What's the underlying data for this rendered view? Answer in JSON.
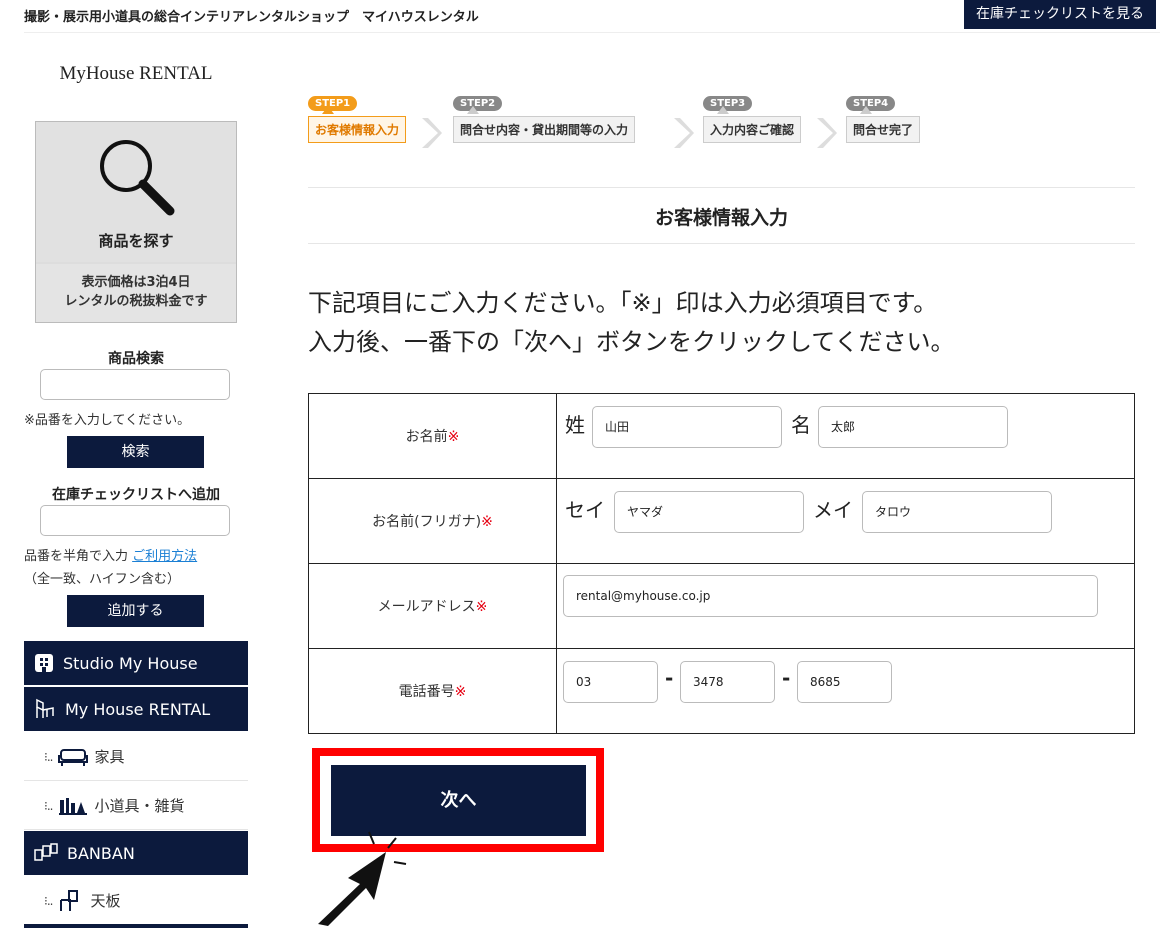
{
  "header": {
    "tagline": "撮影・展示用小道具の総合インテリアレンタルショップ　マイハウスレンタル",
    "checklist_link": "在庫チェックリストを見る"
  },
  "sidebar": {
    "logo": "MyHouse RENTAL",
    "search_box": {
      "title": "商品を探す",
      "price_note_line1": "表示価格は3泊4日",
      "price_note_line2": "レンタルの税抜料金です"
    },
    "product_search": {
      "label": "商品検索",
      "value": "",
      "note": "※品番を入力してください。",
      "button": "検索"
    },
    "checklist_add": {
      "label": "在庫チェックリストへ追加",
      "value": "",
      "note_prefix": "品番を半角で入力 ",
      "note_link": "ご利用方法",
      "note2": "（全一致、ハイフン含む）",
      "button": "追加する"
    },
    "nav": [
      {
        "label": "Studio My House",
        "icon": "building-icon"
      },
      {
        "label": "My House RENTAL",
        "icon": "chair-icon"
      },
      {
        "label": "家具",
        "icon": "sofa-icon"
      },
      {
        "label": "小道具・雑貨",
        "icon": "props-icon"
      },
      {
        "label": "BANBAN",
        "icon": "banban-logo-icon"
      },
      {
        "label": "天板",
        "icon": "tabletop-icon"
      }
    ]
  },
  "steps": [
    {
      "badge": "STEP1",
      "label": "お客様情報入力",
      "active": true
    },
    {
      "badge": "STEP2",
      "label": "問合せ内容・貸出期間等の入力",
      "active": false
    },
    {
      "badge": "STEP3",
      "label": "入力内容ご確認",
      "active": false
    },
    {
      "badge": "STEP4",
      "label": "問合せ完了",
      "active": false
    }
  ],
  "section_title": "お客様情報入力",
  "instructions": {
    "line1": "下記項目にご入力ください。「※」印は入力必須項目です。",
    "line2": "入力後、一番下の「次へ」ボタンをクリックしてください。"
  },
  "form": {
    "required_mark": "※",
    "name": {
      "label": "お名前",
      "last_label": "姓",
      "last_value": "山田",
      "first_label": "名",
      "first_value": "太郎"
    },
    "kana": {
      "label": "お名前(フリガナ)",
      "last_label": "セイ",
      "last_value": "ヤマダ",
      "first_label": "メイ",
      "first_value": "タロウ"
    },
    "email": {
      "label": "メールアドレス",
      "value": "rental@myhouse.co.jp"
    },
    "phone": {
      "label": "電話番号",
      "part1": "03",
      "part2": "3478",
      "part3": "8685",
      "separator": "-"
    }
  },
  "next_button": "次へ",
  "colors": {
    "navy": "#0c1a3d",
    "accent_orange": "#f39c1a",
    "required_red": "#e60012",
    "highlight_red": "#ff0000",
    "link_blue": "#1a7fd4"
  }
}
